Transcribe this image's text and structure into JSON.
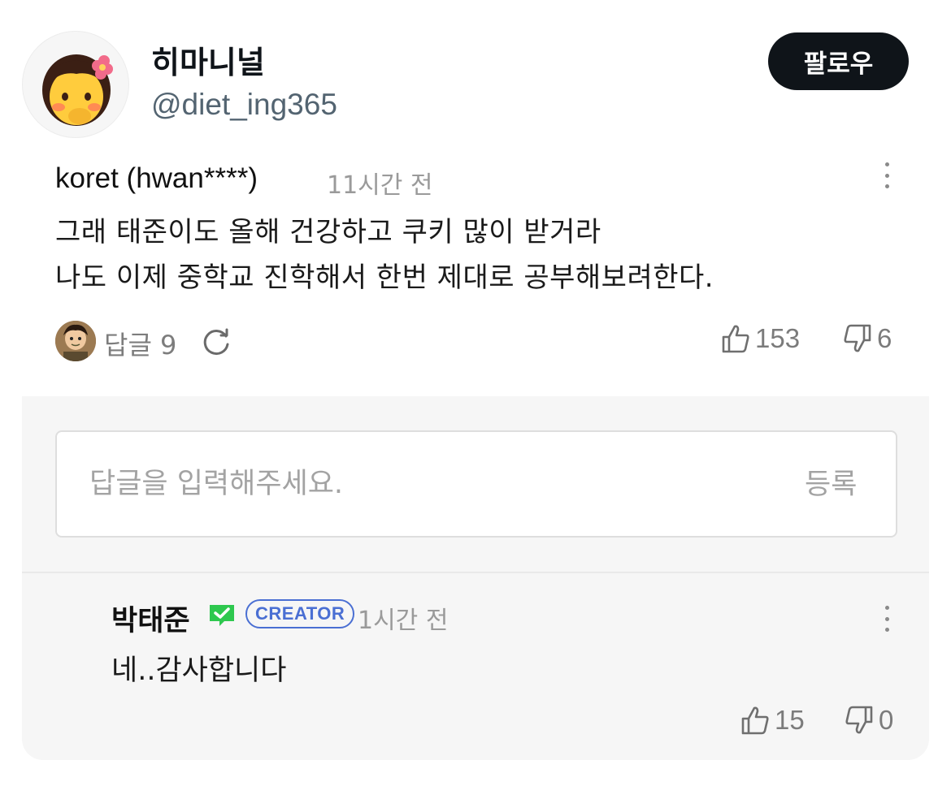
{
  "header": {
    "display_name": "히마니널",
    "handle": "@diet_ing365",
    "follow_label": "팔로우"
  },
  "comment": {
    "author": "koret (hwan****)",
    "time": "11시간 전",
    "lines": [
      "그래 태준이도 올해 건강하고 쿠키 많이 받거라",
      "나도 이제 중학교 진학해서 한번 제대로 공부해보려한다."
    ],
    "reply_label": "답글 9",
    "likes": "153",
    "dislikes": "6"
  },
  "reply_box": {
    "placeholder": "답글을 입력해주세요.",
    "submit_label": "등록"
  },
  "reply": {
    "author": "박태준",
    "badge": "CREATOR",
    "time": "1시간 전",
    "text": "네..감사합니다",
    "likes": "15",
    "dislikes": "0"
  },
  "colors": {
    "follow_button": "#0f1419",
    "creator_badge": "#4a6fd3",
    "verified": "#2ec84f",
    "panel_background": "#f6f6f6"
  },
  "icons": [
    "avatar-emoji",
    "refresh-icon",
    "thumbs-up-icon",
    "thumbs-down-icon",
    "verified-check-icon",
    "more-vertical-icon"
  ]
}
